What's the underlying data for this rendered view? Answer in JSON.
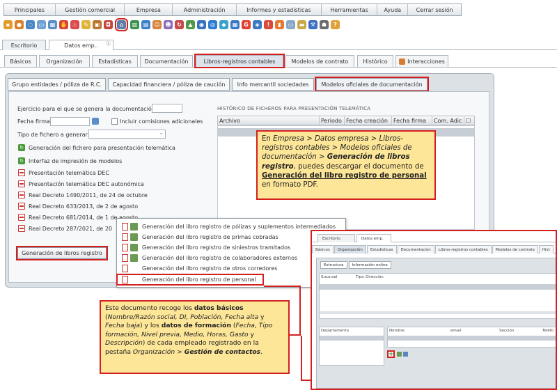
{
  "menu": [
    {
      "label": "Principales",
      "w": 74
    },
    {
      "label": "Gestión comercial",
      "w": 100
    },
    {
      "label": "Empresa",
      "w": 69
    },
    {
      "label": "Administración",
      "w": 92
    },
    {
      "label": "Informes y estadísticas",
      "w": 122
    },
    {
      "label": "Herramientas",
      "w": 81
    },
    {
      "label": "Ayuda",
      "w": 44
    },
    {
      "label": "Cerrar sesión",
      "w": 76
    }
  ],
  "window_tabs": {
    "escritorio": "Escritorio",
    "datos_emp": "Datos emp.."
  },
  "section_tabs": {
    "basicos": "Básicos",
    "organizacion": "Organización",
    "estadisticas": "Estadísticas",
    "documentacion": "Documentación",
    "libros": "Libros-registros contables",
    "modelos_contrato": "Modelos de contrato",
    "historico": "Histórico",
    "interacciones": "Interacciones"
  },
  "sub_tabs": {
    "grupo": "Grupo entidades / póliza de R.C.",
    "capacidad": "Capacidad financiera / póliza de caución",
    "info": "Info mercantil sociedades",
    "modelos": "Modelos oficiales de documentación"
  },
  "form": {
    "ejercicio": "Ejercicio para el que se genera la documentación",
    "fecha_firma": "Fecha firma",
    "incluir": "Incluir comisiones adicionales",
    "tipo": "Tipo de fichero a generar"
  },
  "links": {
    "generacion": "Generación del fichero para presentación telemática",
    "interfaz": "Interfaz de impresión de modelos",
    "pres_dec": "Presentación telemática DEC",
    "pres_dec_aut": "Presentación telemática DEC autonómica",
    "rd1490": "Real Decreto 1490/2011, de 24 de octubre",
    "rd633": "Real Decreto 633/2013, de 2 de agosto",
    "rd681": "Real Decreto 681/2014, de 1 de agosto",
    "rd287": "Real Decreto 287/2021, de 20"
  },
  "gen_button": "Generación de libros registro",
  "history": {
    "title": "HISTÓRICO DE FICHEROS PARA PRESENTACIÓN TELEMÁTICA",
    "cols": {
      "archivo": "Archivo",
      "periodo": "Periodo",
      "fecha_creacion": "Fecha creación",
      "fecha_firma": "Fecha firma",
      "com_adic": "Com. Adic"
    }
  },
  "dropdown": {
    "polizas": "Generación del libro registro de pólizas y suplementos intermediados",
    "primas": "Generación del libro registro de primas cobradas",
    "siniestros": "Generación del libro registro de siniestros tramitados",
    "colaboradores": "Generación del libro registro de colaboradores externos",
    "otros": "Generación del libro registro de otros corredores",
    "personal": "Generación del libro registro de personal"
  },
  "callout1": {
    "p1": "En ",
    "p2": "Empresa > Datos empresa > Libros-registros contables > Modelos oficiales de documentación > ",
    "p3": "Generación de libros registro",
    "p4": ", puedes descargar el documento de ",
    "p5": "Generación del libro registro de personal",
    "p6": " en formato PDF."
  },
  "callout2": {
    "p1": "Este documento recoge los ",
    "p2": "datos básicos",
    "p3": " (",
    "p4": "Nombre/Razón social, DI, Población, Fecha alta",
    "p5": " y ",
    "p6": "Fecha baja",
    "p7": ") y los ",
    "p8": "datos de formación",
    "p9": " (",
    "p10": "Fecha, Tipo formación, Nivel previa, Medio, Horas, Gasto",
    "p11": " y ",
    "p12": "Descripción",
    "p13": ") de cada empleado registrado en la pestaña ",
    "p14": "Organización > ",
    "p15": "Gestión de contactos",
    "p16": "."
  },
  "inset": {
    "wtab1": "Escritorio",
    "wtab2": "Datos emp.",
    "tabs": [
      "Básicos",
      "Organización",
      "Estadísticas",
      "Documentación",
      "Libros-registros contables",
      "Modelos de contrato",
      "Hist"
    ],
    "subtab1": "Estructura",
    "subtab2": "Información online",
    "grid1": {
      "sucursal": "Sucursal",
      "tipo": "Tipo",
      "direccion": "Dirección"
    },
    "grid2": {
      "departamento": "Departamento",
      "nombre": "Nombre",
      "email": "email",
      "seccion": "Sección",
      "telefono": "Teléfo"
    }
  },
  "colors": {
    "highlight": "#d3201f",
    "callout_bg": "#fde698",
    "panel_bg": "#dce1e6"
  }
}
